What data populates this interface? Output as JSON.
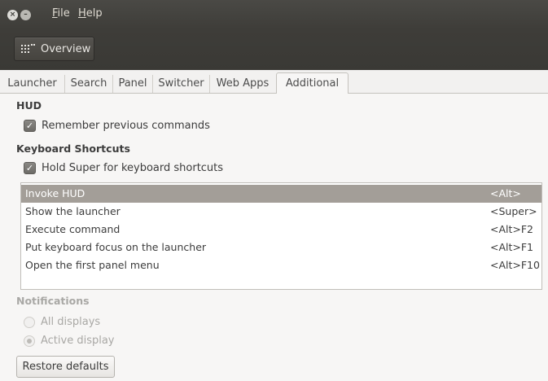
{
  "menubar": {
    "file": "File",
    "help": "Help"
  },
  "toolbar": {
    "overview_label": "Overview"
  },
  "tabs": [
    {
      "label": "Launcher"
    },
    {
      "label": "Search"
    },
    {
      "label": "Panel"
    },
    {
      "label": "Switcher"
    },
    {
      "label": "Web Apps"
    },
    {
      "label": "Additional",
      "active": true
    }
  ],
  "hud": {
    "heading": "HUD",
    "remember_label": "Remember previous commands",
    "remember_checked": true
  },
  "keyboard_shortcuts": {
    "heading": "Keyboard Shortcuts",
    "hold_super_label": "Hold Super for keyboard shortcuts",
    "hold_super_checked": true,
    "items": [
      {
        "action": "Invoke HUD",
        "key": "<Alt>",
        "selected": true
      },
      {
        "action": "Show the launcher",
        "key": "<Super>"
      },
      {
        "action": "Execute command",
        "key": "<Alt>F2"
      },
      {
        "action": "Put keyboard focus on the launcher",
        "key": "<Alt>F1"
      },
      {
        "action": "Open the first panel menu",
        "key": "<Alt>F10"
      }
    ]
  },
  "notifications": {
    "heading": "Notifications",
    "options": [
      {
        "label": "All displays",
        "selected": false
      },
      {
        "label": "Active display",
        "selected": true
      }
    ]
  },
  "restore_defaults_label": "Restore defaults",
  "colors": {
    "titlebar": "#3e3d39",
    "selection": "#a39e98",
    "background": "#f2f1f0"
  }
}
